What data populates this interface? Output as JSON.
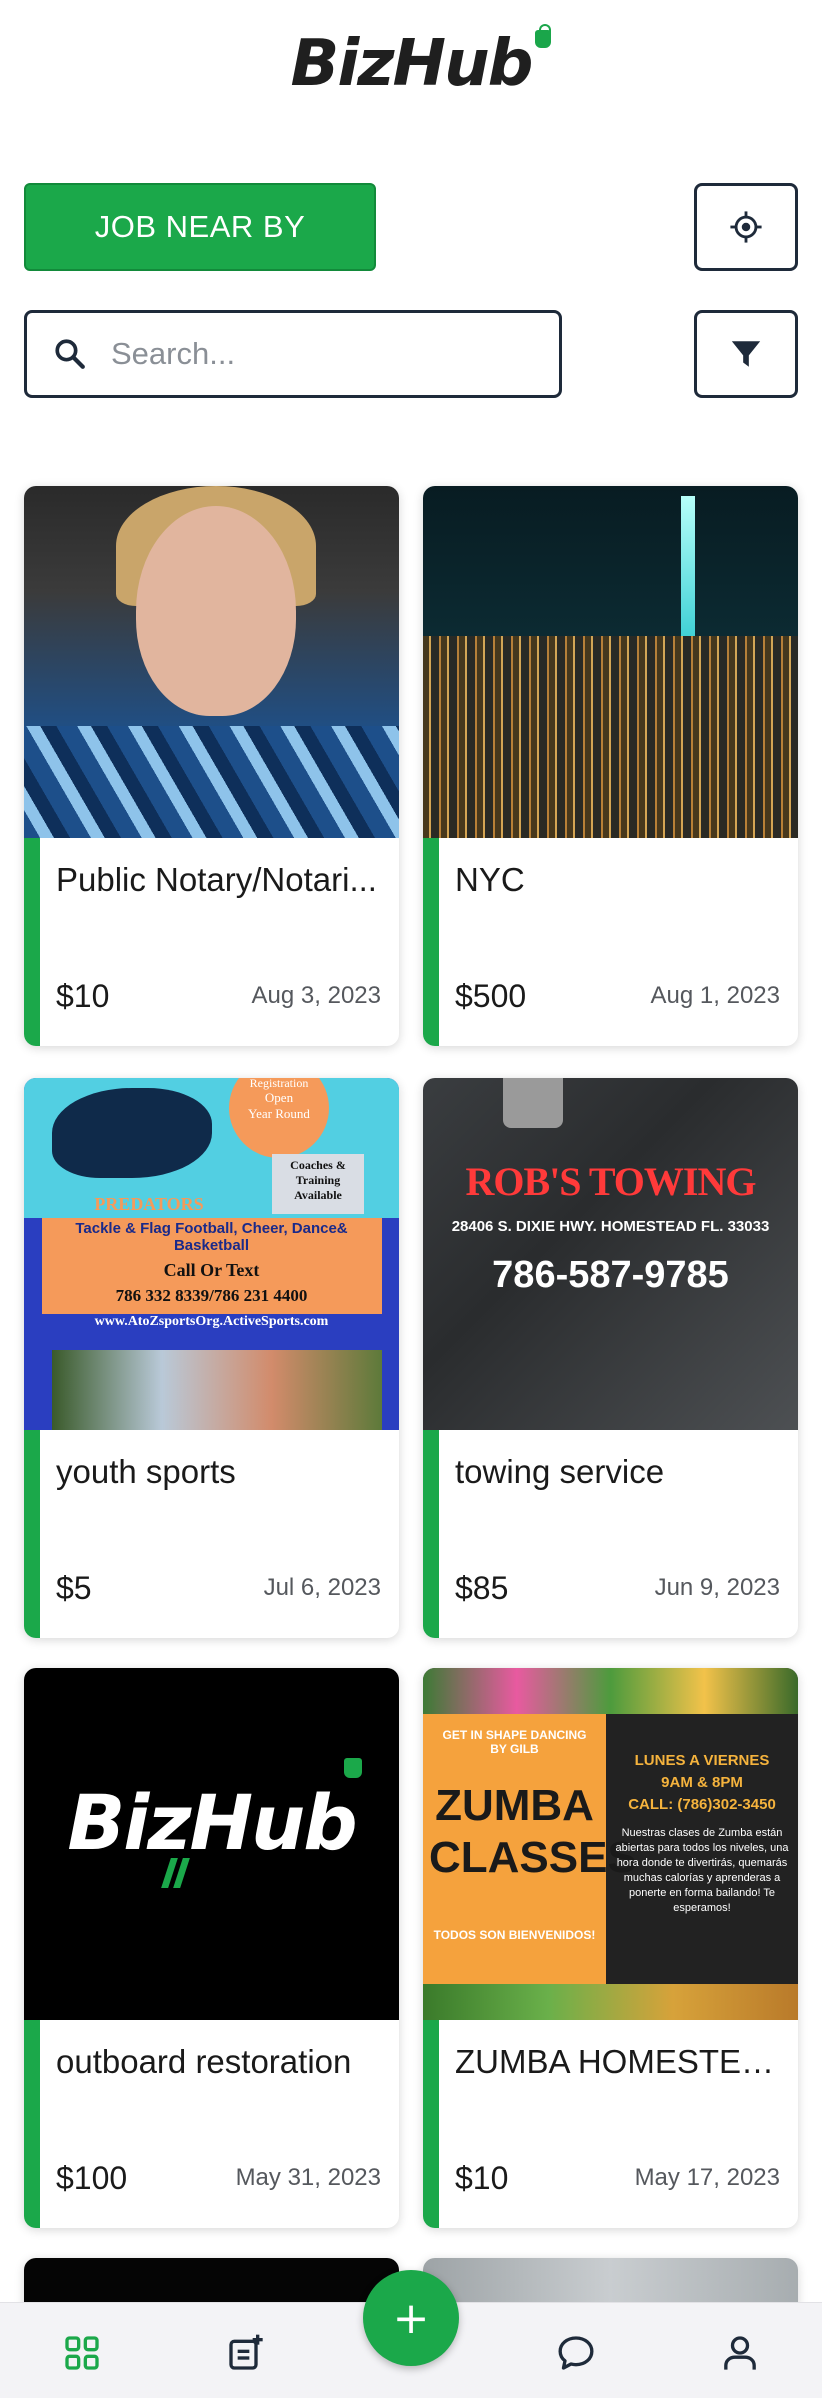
{
  "app": {
    "logo_text": "BizHub"
  },
  "controls": {
    "nearby_label": "JOB NEAR BY",
    "search_placeholder": "Search...",
    "search_value": "",
    "locate_icon": "crosshair-icon",
    "filter_icon": "filter-icon",
    "search_icon": "search-icon"
  },
  "colors": {
    "brand_green": "#1ba84a",
    "dark_border": "#1e2a3a"
  },
  "listings": [
    {
      "title": "Public Notary/Notari...",
      "price": "$10",
      "date": "Aug 3, 2023"
    },
    {
      "title": "NYC",
      "price": "$500",
      "date": "Aug 1, 2023"
    },
    {
      "title": "youth sports",
      "price": "$5",
      "date": "Jul 6, 2023"
    },
    {
      "title": "towing service",
      "price": "$85",
      "date": "Jun 9, 2023"
    },
    {
      "title": "outboard restoration",
      "price": "$100",
      "date": "May 31, 2023"
    },
    {
      "title": "ZUMBA HOMESTEAD",
      "price": "$10",
      "date": "May 17, 2023"
    }
  ],
  "images": {
    "sports": {
      "line1": "Registration",
      "line2": "Open",
      "line3": "Year Round",
      "predators": "PREDATORS",
      "coaches": "Coaches & Training Available",
      "tackle": "Tackle & Flag Football, Cheer, Dance& Basketball",
      "call": "Call Or Text",
      "phones": "786 332 8339/786 231 4400",
      "site": "www.AtoZsportsOrg.ActiveSports.com"
    },
    "towing": {
      "name": "ROB'S TOWING",
      "address": "28406 S. DIXIE HWY. HOMESTEAD FL. 33033",
      "phone": "786-587-9785"
    },
    "logo_card": {
      "text": "BizHub"
    },
    "zumba": {
      "tag": "GET IN SHAPE DANCING BY GILB",
      "headline": "ZUMBA CLASSES",
      "welcome": "TODOS SON BIENVENIDOS!",
      "days": "LUNES A VIERNES",
      "hours": "9AM & 8PM",
      "call": "CALL: (786)302-3450",
      "body": "Nuestras clases de Zumba están abiertas para todos los niveles, una hora donde te divertirás, quemarás muchas calorías y aprenderas a ponerte en forma bailando! Te esperamos!"
    }
  },
  "bottom_nav": {
    "items": [
      "grid-icon",
      "post-icon",
      "add-icon",
      "chat-icon",
      "profile-icon"
    ],
    "fab_symbol": "+"
  }
}
